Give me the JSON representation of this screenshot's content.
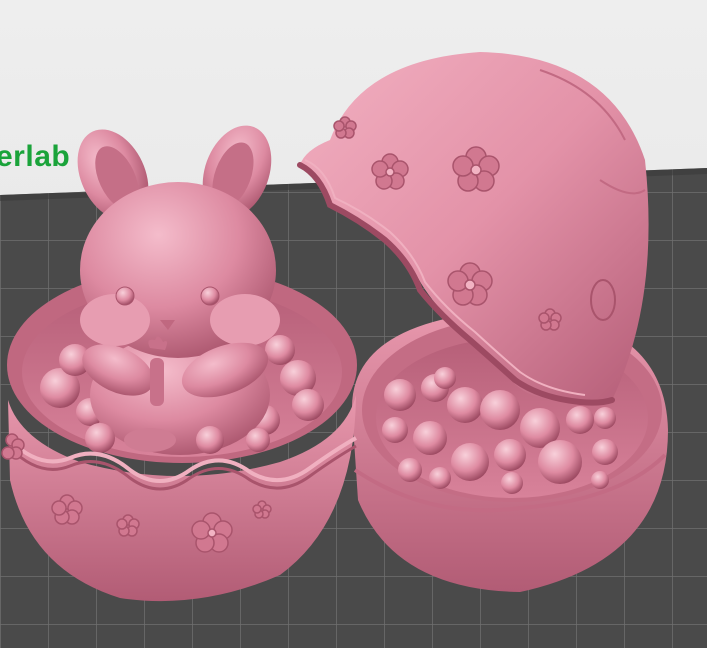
{
  "viewport": {
    "brand_fragment": "erlab",
    "colors": {
      "background": "#e6e6e6",
      "bed_dark": "#4a4a4a",
      "bed_grid_line": "#6f6f6f",
      "model_pink": "#d97c96",
      "model_highlight": "#f2b3c3",
      "model_shadow": "#a9546c",
      "brand_green": "#1aa33a"
    },
    "objects": [
      {
        "name": "bunny",
        "icon": "bunny-figure"
      },
      {
        "name": "egg-bottom-left",
        "icon": "egg-cup"
      },
      {
        "name": "egg-bottom-right",
        "icon": "egg-cup"
      },
      {
        "name": "egg-lid",
        "icon": "egg-shell"
      }
    ]
  }
}
